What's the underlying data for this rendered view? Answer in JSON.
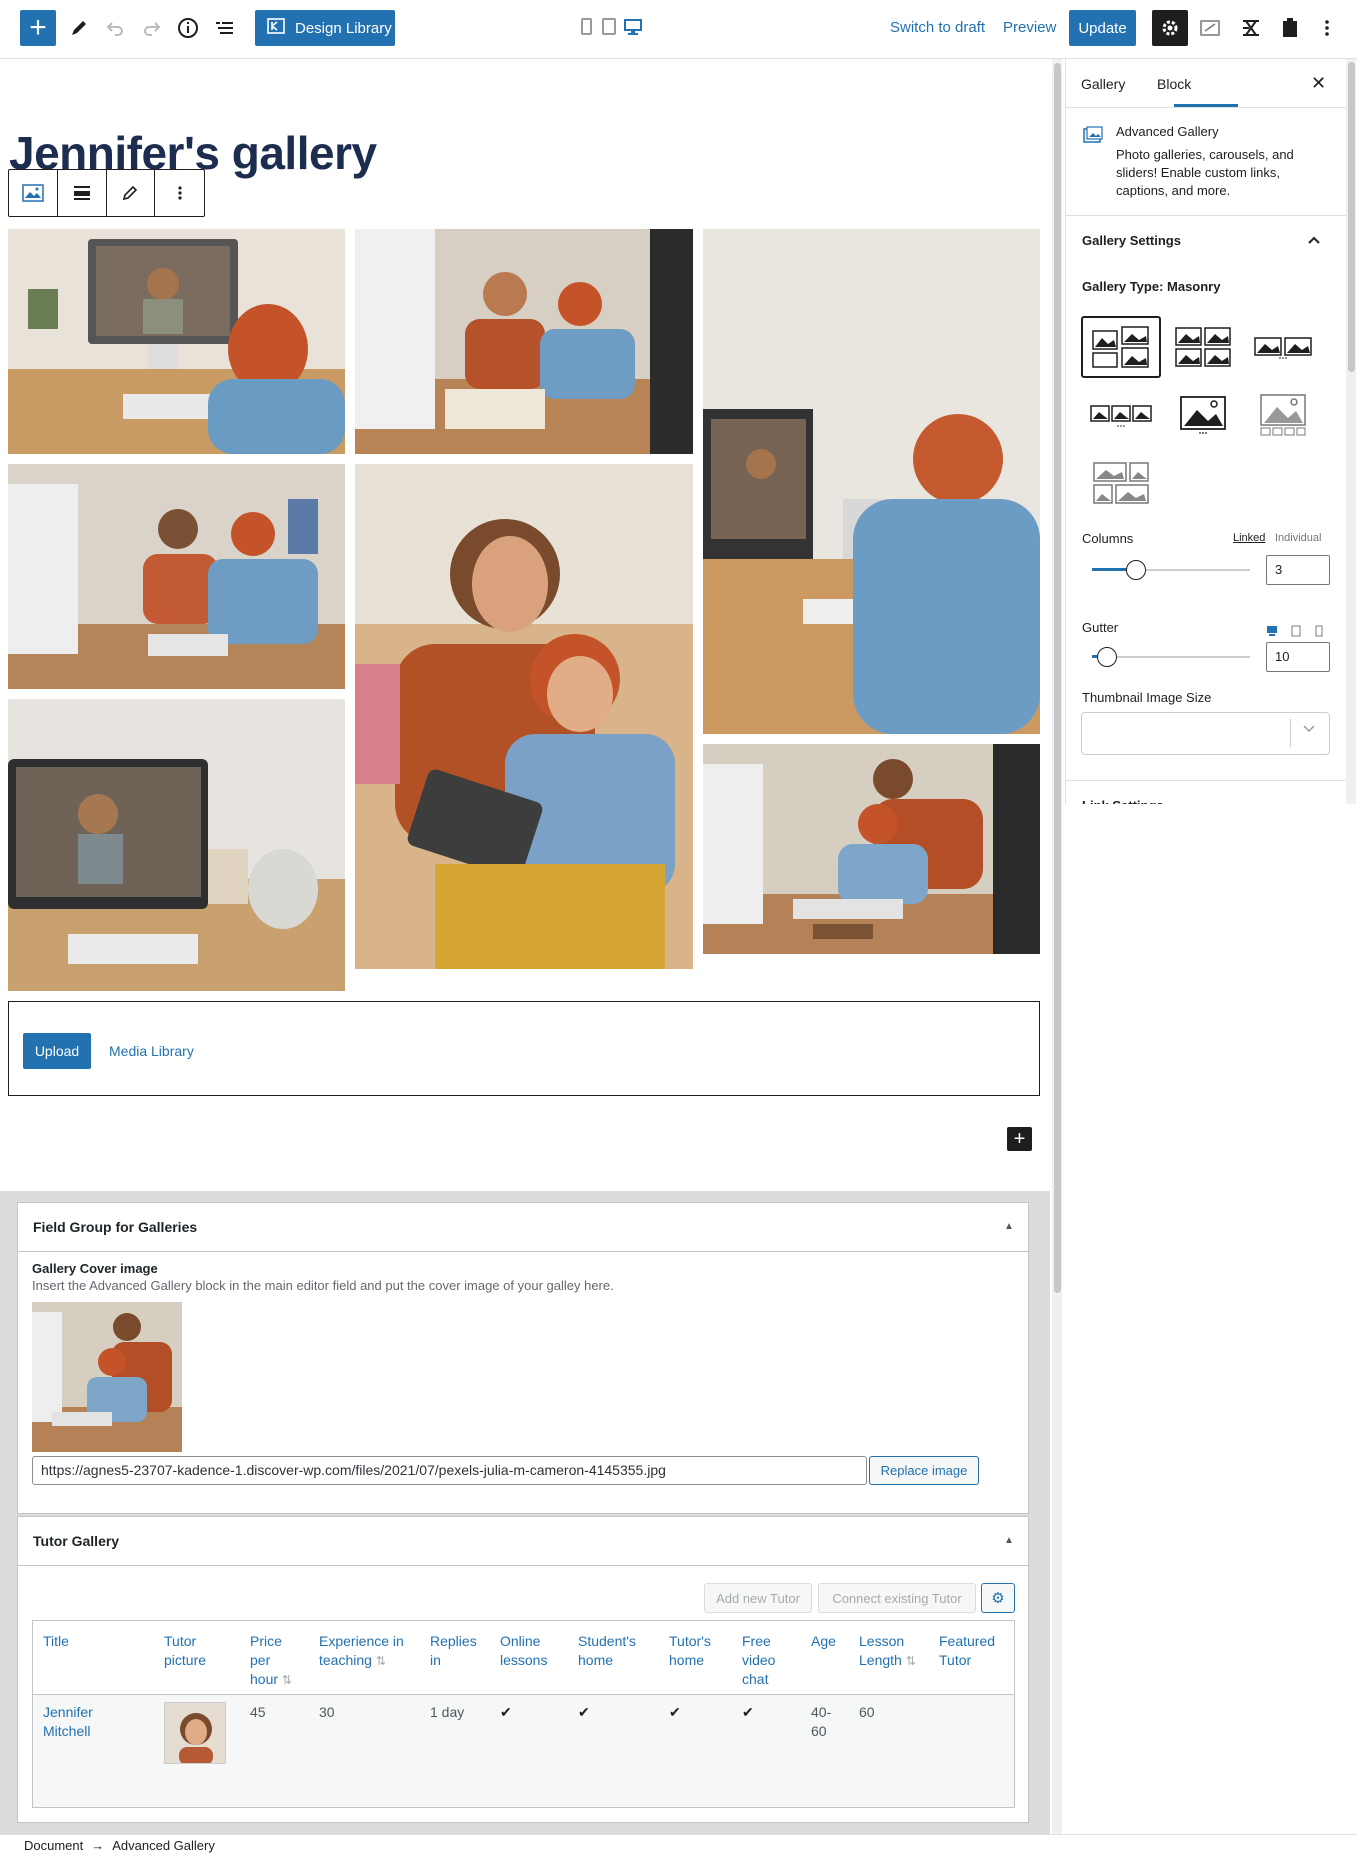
{
  "toolbar": {
    "design_library_label": "Design Library",
    "switch_to_draft": "Switch to draft",
    "preview": "Preview",
    "update": "Update"
  },
  "editor": {
    "page_title": "Jennifer's gallery",
    "upload_label": "Upload",
    "media_library_label": "Media Library"
  },
  "sidebar": {
    "tabs": [
      "Gallery",
      "Block"
    ],
    "active_tab": "Block",
    "block_name": "Advanced Gallery",
    "block_description": "Photo galleries, carousels, and sliders! Enable custom links, captions, and more.",
    "panel_title": "Gallery Settings",
    "gallery_type": "Gallery Type: Masonry",
    "columns_label": "Columns",
    "columns_linked": "Linked",
    "columns_individual": "Individual",
    "columns_value": "3",
    "gutter_label": "Gutter",
    "gutter_value": "10",
    "thumbnail_label": "Thumbnail Image Size",
    "next_panel": "Link Settings"
  },
  "metaboxes": {
    "field_group_title": "Field Group for Galleries",
    "cover_label": "Gallery Cover image",
    "cover_description": "Insert the Advanced Gallery block in the main editor field and put the cover image of your galley here.",
    "cover_url": "https://agnes5-23707-kadence-1.discover-wp.com/files/2021/07/pexels-julia-m-cameron-4145355.jpg",
    "replace_image": "Replace image",
    "tutor_gallery_title": "Tutor Gallery",
    "add_new_tutor": "Add new Tutor",
    "connect_existing_tutor": "Connect existing Tutor",
    "table": {
      "headers": [
        "Title",
        "Tutor picture",
        "Price per hour",
        "Experience in teaching",
        "Replies in",
        "Online lessons",
        "Student's home",
        "Tutor's home",
        "Free video chat",
        "Age",
        "Lesson Length",
        "Featured Tutor"
      ],
      "rows": [
        {
          "title": "Jennifer Mitchell",
          "price": "45",
          "experience": "30",
          "replies": "1 day",
          "online": "✔",
          "students_home": "✔",
          "tutors_home": "✔",
          "free_video": "✔",
          "age": "40-60",
          "lesson_length": "60",
          "featured": ""
        }
      ]
    }
  },
  "statusbar": {
    "crumb_1": "Document",
    "arrow": "→",
    "crumb_2": "Advanced Gallery"
  },
  "colors": {
    "accent": "#2271b1",
    "title": "#1d2d50",
    "meta_bg": "#dcdcde"
  }
}
